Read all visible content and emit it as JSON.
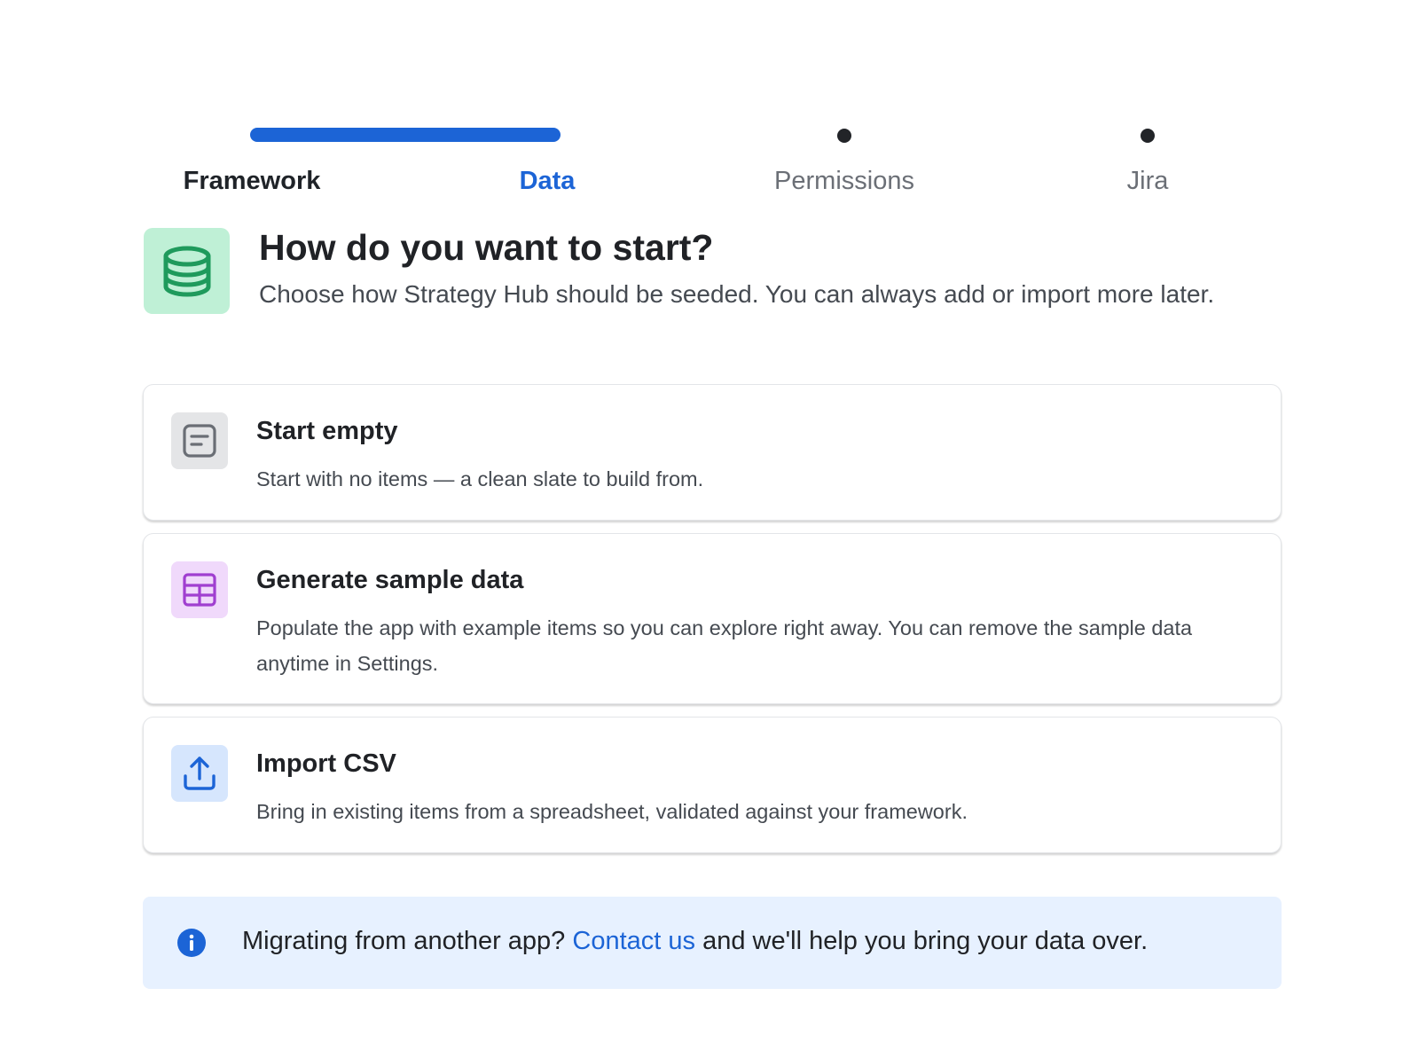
{
  "stepper": {
    "steps": [
      {
        "label": "Framework",
        "state": "done"
      },
      {
        "label": "Data",
        "state": "active"
      },
      {
        "label": "Permissions",
        "state": "pending"
      },
      {
        "label": "Jira",
        "state": "pending"
      }
    ]
  },
  "header": {
    "icon": "database-icon",
    "title": "How do you want to start?",
    "subtitle": "Choose how Strategy Hub should be seeded. You can always add or import more later."
  },
  "options": [
    {
      "icon": "document-icon",
      "title": "Start empty",
      "description": "Start with no items — a clean slate to build from."
    },
    {
      "icon": "table-icon",
      "title": "Generate sample data",
      "description": "Populate the app with example items so you can explore right away. You can remove the sample data anytime in Settings."
    },
    {
      "icon": "upload-icon",
      "title": "Import CSV",
      "description": "Bring in existing items from a spreadsheet, validated against your framework."
    }
  ],
  "info_banner": {
    "icon": "info-icon",
    "text_before": "Migrating from another app? ",
    "link_label": "Contact us",
    "text_after": " and we'll help you bring your data over."
  },
  "colors": {
    "accent": "#1c64d6",
    "header_icon_bg": "#bff0d6",
    "header_icon_fg": "#1f9a5c",
    "option_empty_bg": "#e4e5e7",
    "option_sample_bg": "#f0d9fb",
    "option_import_bg": "#d6e6fd",
    "info_bg": "#e7f1ff"
  }
}
